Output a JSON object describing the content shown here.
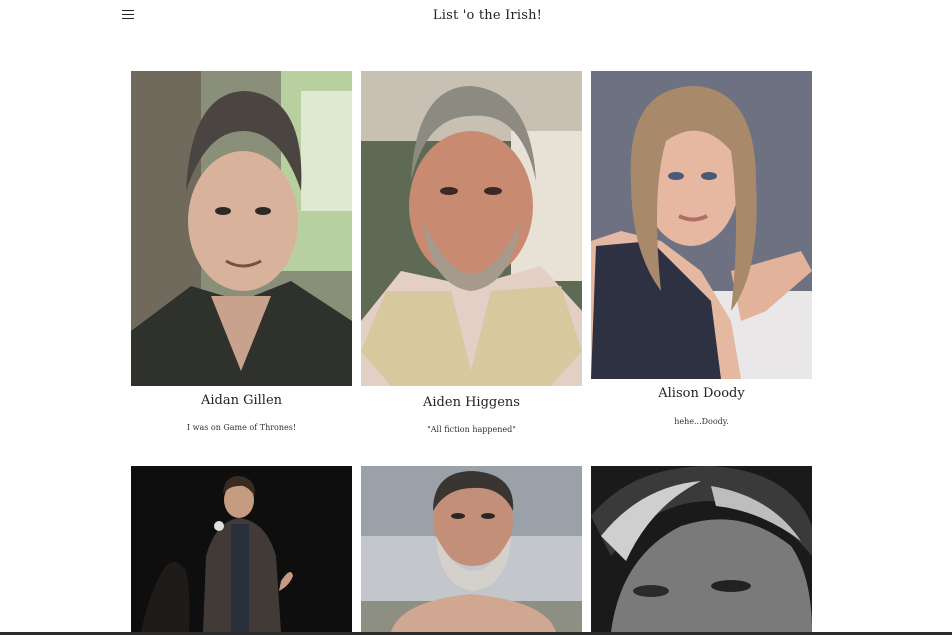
{
  "header": {
    "title": "List 'o the Irish!",
    "menu_icon": "hamburger-menu-icon"
  },
  "people": [
    {
      "name": "Aidan Gillen",
      "quote": "I was on Game of Thrones!"
    },
    {
      "name": "Aiden Higgens",
      "quote": "\"All fiction happened\""
    },
    {
      "name": "Alison Doody",
      "quote": "hehe...Doody."
    },
    {
      "name": "",
      "quote": ""
    },
    {
      "name": "",
      "quote": ""
    },
    {
      "name": "",
      "quote": ""
    }
  ]
}
